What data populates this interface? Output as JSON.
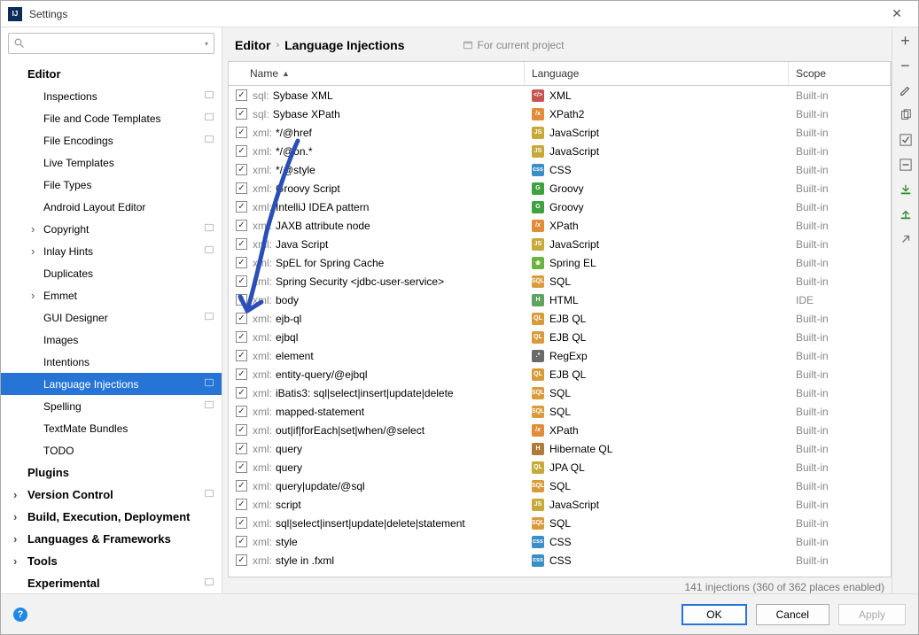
{
  "window": {
    "title": "Settings"
  },
  "search": {
    "placeholder": ""
  },
  "sidebar": {
    "items": [
      {
        "label": "Editor",
        "level": 1,
        "expand": ""
      },
      {
        "label": "Inspections",
        "level": 2,
        "corner": true
      },
      {
        "label": "File and Code Templates",
        "level": 2,
        "corner": true
      },
      {
        "label": "File Encodings",
        "level": 2,
        "corner": true
      },
      {
        "label": "Live Templates",
        "level": 2
      },
      {
        "label": "File Types",
        "level": 2
      },
      {
        "label": "Android Layout Editor",
        "level": 2
      },
      {
        "label": "Copyright",
        "level": 2,
        "chev": ">",
        "corner": true
      },
      {
        "label": "Inlay Hints",
        "level": 2,
        "chev": ">",
        "corner": true
      },
      {
        "label": "Duplicates",
        "level": 2
      },
      {
        "label": "Emmet",
        "level": 2,
        "chev": ">"
      },
      {
        "label": "GUI Designer",
        "level": 2,
        "corner": true
      },
      {
        "label": "Images",
        "level": 2
      },
      {
        "label": "Intentions",
        "level": 2
      },
      {
        "label": "Language Injections",
        "level": 2,
        "selected": true,
        "corner": true
      },
      {
        "label": "Spelling",
        "level": 2,
        "corner": true
      },
      {
        "label": "TextMate Bundles",
        "level": 2
      },
      {
        "label": "TODO",
        "level": 2
      },
      {
        "label": "Plugins",
        "level": 1
      },
      {
        "label": "Version Control",
        "level": 1,
        "chev": ">",
        "corner": true
      },
      {
        "label": "Build, Execution, Deployment",
        "level": 1,
        "chev": ">"
      },
      {
        "label": "Languages & Frameworks",
        "level": 1,
        "chev": ">"
      },
      {
        "label": "Tools",
        "level": 1,
        "chev": ">"
      },
      {
        "label": "Experimental",
        "level": 1,
        "corner": true
      }
    ]
  },
  "breadcrumb": {
    "root": "Editor",
    "leaf": "Language Injections",
    "project_hint": "For current project"
  },
  "columns": {
    "name": "Name",
    "lang": "Language",
    "scope": "Scope"
  },
  "rows": [
    {
      "prefix": "sql:",
      "name": "Sybase XML",
      "lang": "XML",
      "icon": "xml",
      "scope": "Built-in"
    },
    {
      "prefix": "sql:",
      "name": "Sybase XPath",
      "lang": "XPath2",
      "icon": "xpath",
      "scope": "Built-in"
    },
    {
      "prefix": "xml:",
      "name": "*/@href",
      "lang": "JavaScript",
      "icon": "js",
      "scope": "Built-in"
    },
    {
      "prefix": "xml:",
      "name": "*/@on.*",
      "lang": "JavaScript",
      "icon": "js",
      "scope": "Built-in"
    },
    {
      "prefix": "xml:",
      "name": "*/@style",
      "lang": "CSS",
      "icon": "css",
      "scope": "Built-in"
    },
    {
      "prefix": "xml:",
      "name": "Groovy Script",
      "lang": "Groovy",
      "icon": "groovy",
      "scope": "Built-in"
    },
    {
      "prefix": "xml:",
      "name": "IntelliJ IDEA pattern",
      "lang": "Groovy",
      "icon": "groovy",
      "scope": "Built-in"
    },
    {
      "prefix": "xml:",
      "name": "JAXB attribute node",
      "lang": "XPath",
      "icon": "xpath",
      "scope": "Built-in"
    },
    {
      "prefix": "xml:",
      "name": "Java Script",
      "lang": "JavaScript",
      "icon": "js",
      "scope": "Built-in"
    },
    {
      "prefix": "xml:",
      "name": "SpEL for Spring Cache",
      "lang": "Spring EL",
      "icon": "spring",
      "scope": "Built-in"
    },
    {
      "prefix": "xml:",
      "name": "Spring Security <jdbc-user-service>",
      "lang": "SQL",
      "icon": "sql",
      "scope": "Built-in"
    },
    {
      "prefix": "xml:",
      "name": "body",
      "lang": "HTML",
      "icon": "html",
      "scope": "IDE"
    },
    {
      "prefix": "xml:",
      "name": "ejb-ql",
      "lang": "EJB QL",
      "icon": "ejb",
      "scope": "Built-in"
    },
    {
      "prefix": "xml:",
      "name": "ejbql",
      "lang": "EJB QL",
      "icon": "ejb",
      "scope": "Built-in"
    },
    {
      "prefix": "xml:",
      "name": "element",
      "lang": "RegExp",
      "icon": "regex",
      "scope": "Built-in"
    },
    {
      "prefix": "xml:",
      "name": "entity-query/@ejbql",
      "lang": "EJB QL",
      "icon": "ejb",
      "scope": "Built-in"
    },
    {
      "prefix": "xml:",
      "name": "iBatis3: sql|select|insert|update|delete",
      "lang": "SQL",
      "icon": "sql",
      "scope": "Built-in"
    },
    {
      "prefix": "xml:",
      "name": "mapped-statement",
      "lang": "SQL",
      "icon": "sql",
      "scope": "Built-in"
    },
    {
      "prefix": "xml:",
      "name": "out|if|forEach|set|when/@select",
      "lang": "XPath",
      "icon": "xpath",
      "scope": "Built-in"
    },
    {
      "prefix": "xml:",
      "name": "query",
      "lang": "Hibernate QL",
      "icon": "hib",
      "scope": "Built-in"
    },
    {
      "prefix": "xml:",
      "name": "query",
      "lang": "JPA QL",
      "icon": "jpa",
      "scope": "Built-in"
    },
    {
      "prefix": "xml:",
      "name": "query|update/@sql",
      "lang": "SQL",
      "icon": "sql",
      "scope": "Built-in"
    },
    {
      "prefix": "xml:",
      "name": "script",
      "lang": "JavaScript",
      "icon": "js",
      "scope": "Built-in"
    },
    {
      "prefix": "xml:",
      "name": "sql|select|insert|update|delete|statement",
      "lang": "SQL",
      "icon": "sql",
      "scope": "Built-in"
    },
    {
      "prefix": "xml:",
      "name": "style",
      "lang": "CSS",
      "icon": "css",
      "scope": "Built-in"
    },
    {
      "prefix": "xml:",
      "name": "style in .fxml",
      "lang": "CSS",
      "icon": "css",
      "scope": "Built-in"
    }
  ],
  "status": "141 injections (360 of 362 places enabled)",
  "buttons": {
    "ok": "OK",
    "cancel": "Cancel",
    "apply": "Apply"
  },
  "icon_colors": {
    "xml": "#c75450",
    "xpath": "#e08c3b",
    "js": "#c7a93a",
    "css": "#3a8fc7",
    "groovy": "#3fa13f",
    "spring": "#6db33f",
    "sql": "#d99b3a",
    "html": "#5fa35f",
    "ejb": "#d99b3a",
    "regex": "#6a6a6a",
    "hib": "#b07a3a",
    "jpa": "#c7a93a"
  },
  "icon_text": {
    "xml": "</>",
    "xpath": "/x",
    "js": "JS",
    "css": "css",
    "groovy": "G",
    "spring": "❀",
    "sql": "SQL",
    "html": "H",
    "ejb": "QL",
    "regex": ".*",
    "hib": "H",
    "jpa": "QL"
  }
}
